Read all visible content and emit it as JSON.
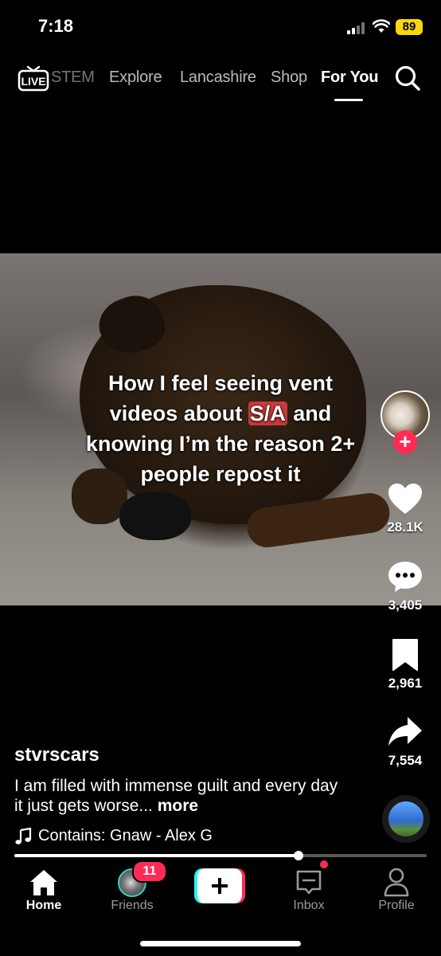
{
  "status_bar": {
    "time": "7:18",
    "battery": "89"
  },
  "top_nav": {
    "live_label": "LIVE",
    "tabs": [
      {
        "label": "STEM",
        "active": false
      },
      {
        "label": "Explore",
        "active": false
      },
      {
        "label": "Lancashire",
        "active": false
      },
      {
        "label": "Shop",
        "active": false
      },
      {
        "label": "For You",
        "active": true
      }
    ]
  },
  "video": {
    "caption_line1": "How I feel seeing vent",
    "caption_line2_pre": "videos about ",
    "caption_emoji": "S/A",
    "caption_line2_post": " and",
    "caption_line3": "knowing I’m the reason 2+",
    "caption_line4": "people repost it",
    "progress": 0.69
  },
  "actions": {
    "likes": "28.1K",
    "comments": "3,405",
    "saves": "2,961",
    "shares": "7,554"
  },
  "post": {
    "username": "stvrscars",
    "description": "I am filled with immense guilt and every day it just gets worse...",
    "more_label": "more",
    "music": "Contains: Gnaw - Alex G"
  },
  "tab_bar": {
    "home": "Home",
    "friends": "Friends",
    "friends_badge": "11",
    "inbox": "Inbox",
    "profile": "Profile"
  },
  "colors": {
    "accent": "#fe2c55",
    "battery": "#ffd60a"
  }
}
